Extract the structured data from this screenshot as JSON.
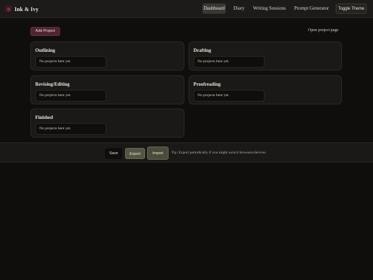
{
  "brand": {
    "name": "Ink & Ivy",
    "icon": "quill-icon"
  },
  "nav": {
    "items": [
      "Dashboard",
      "Diary",
      "Writing Sessions",
      "Prompt Generator"
    ],
    "active": "Dashboard",
    "toggle_label": "Toggle Theme"
  },
  "toolbar": {
    "add_label": "Add Project",
    "open_label": "Open project page"
  },
  "columns": [
    {
      "title": "Outlining",
      "empty": "No projects here yet."
    },
    {
      "title": "Drafting",
      "empty": "No projects here yet."
    },
    {
      "title": "Revising/Editing",
      "empty": "No projects here yet."
    },
    {
      "title": "Proofreading",
      "empty": "No projects here yet."
    },
    {
      "title": "Finished",
      "empty": "No projects here yet."
    }
  ],
  "footer": {
    "save_label": "Save",
    "export_label": "Export",
    "import_label": "Import",
    "tip": "Tip: Export periodically if you might switch browsers/devices."
  },
  "colors": {
    "background": "#0f0e0d",
    "surface": "#1a1917",
    "accent": "#4e2530",
    "button_olive": "#545542"
  }
}
